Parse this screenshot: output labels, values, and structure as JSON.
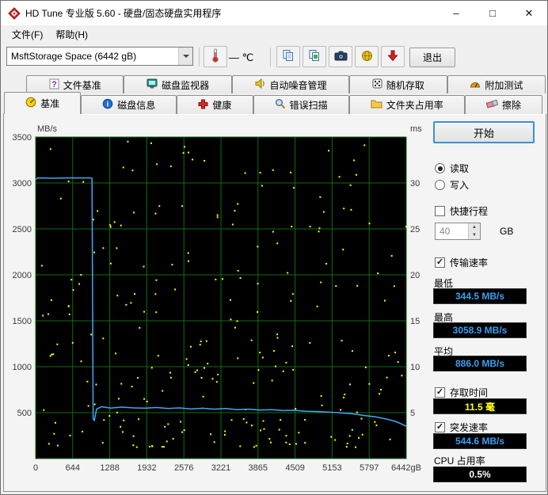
{
  "window": {
    "title": "HD Tune 专业版 5.60 - 硬盘/固态硬盘实用程序",
    "controls": {
      "minimize": "–",
      "maximize": "□",
      "close": "✕"
    }
  },
  "menu": {
    "file_label": "文件(F)",
    "help_label": "帮助(H)"
  },
  "toolbar": {
    "drive_select": "MsftStorage Space (6442 gB)",
    "temperature": "—",
    "temperature_unit": "℃",
    "exit_label": "退出"
  },
  "tabs": {
    "row1": [
      {
        "label": "文件基准"
      },
      {
        "label": "磁盘监视器"
      },
      {
        "label": "自动噪音管理"
      },
      {
        "label": "随机存取"
      },
      {
        "label": "附加测试"
      }
    ],
    "row2": [
      {
        "label": "基准",
        "active": true
      },
      {
        "label": "磁盘信息"
      },
      {
        "label": "健康"
      },
      {
        "label": "错误扫描"
      },
      {
        "label": "文件夹占用率"
      },
      {
        "label": "擦除"
      }
    ]
  },
  "panel": {
    "start_label": "开始",
    "read_label": "读取",
    "write_label": "写入",
    "shortstroke_label": "快捷行程",
    "shortstroke_value": "40",
    "shortstroke_unit": "GB",
    "transfer_label": "传输速率",
    "min_label": "最低",
    "min_value": "344.5 MB/s",
    "max_label": "最高",
    "max_value": "3058.9 MB/s",
    "avg_label": "平均",
    "avg_value": "886.0 MB/s",
    "access_label": "存取时间",
    "access_value": "11.5 毫",
    "burst_label": "突发速率",
    "burst_value": "544.6 MB/s",
    "cpu_label": "CPU 占用率",
    "cpu_value": "0.5%"
  },
  "colors": {
    "value_blue": "#35a2f0",
    "value_yellow": "#ffff00",
    "value_white": "#ffffff",
    "accent_border": "#3d8fd4"
  },
  "chart_data": {
    "type": "line+scatter",
    "title": "HD Tune 基准 读取测试",
    "x_axis": {
      "min": 0,
      "max": 6442,
      "tick_labels": [
        "0",
        "644",
        "1288",
        "1932",
        "2576",
        "3221",
        "3865",
        "4509",
        "5153",
        "5797",
        "6442gB"
      ]
    },
    "left_axis": {
      "unit": "MB/s",
      "min": 0,
      "max": 3500,
      "ticks": [
        3500,
        3000,
        2500,
        2000,
        1500,
        1000,
        500
      ]
    },
    "right_axis": {
      "unit": "ms",
      "min": 0,
      "max": 35,
      "ticks": [
        30,
        25,
        20,
        15,
        10,
        5
      ]
    },
    "grid": true,
    "bg": "#000000",
    "grid_color": "#0e6e0e",
    "transfer_line": {
      "name": "传输速率",
      "color": "#3fa9f5",
      "points": [
        [
          0,
          3040
        ],
        [
          40,
          3055
        ],
        [
          300,
          3052
        ],
        [
          600,
          3055
        ],
        [
          950,
          3055
        ],
        [
          980,
          3050
        ],
        [
          1000,
          430
        ],
        [
          1020,
          415
        ],
        [
          1060,
          540
        ],
        [
          1150,
          565
        ],
        [
          1300,
          550
        ],
        [
          1500,
          560
        ],
        [
          1700,
          552
        ],
        [
          1900,
          548
        ],
        [
          2100,
          556
        ],
        [
          2300,
          545
        ],
        [
          2500,
          552
        ],
        [
          2700,
          540
        ],
        [
          2900,
          548
        ],
        [
          3100,
          538
        ],
        [
          3300,
          545
        ],
        [
          3500,
          532
        ],
        [
          3700,
          538
        ],
        [
          3900,
          528
        ],
        [
          4100,
          532
        ],
        [
          4300,
          522
        ],
        [
          4500,
          526
        ],
        [
          4700,
          515
        ],
        [
          4900,
          512
        ],
        [
          5100,
          505
        ],
        [
          5300,
          498
        ],
        [
          5500,
          488
        ],
        [
          5700,
          470
        ],
        [
          5900,
          455
        ],
        [
          6100,
          430
        ],
        [
          6250,
          405
        ],
        [
          6350,
          380
        ],
        [
          6442,
          352
        ]
      ]
    },
    "access_scatter": {
      "name": "存取时间",
      "color": "#ffff00",
      "count": 250,
      "ms_min": 1.2,
      "ms_max": 34.5,
      "bias": 1.45,
      "seed": 1337
    },
    "summary": {
      "min_mbs": 344.5,
      "max_mbs": 3058.9,
      "avg_mbs": 886.0,
      "access_ms": 11.5,
      "burst_mbs": 544.6,
      "cpu_pct": 0.5
    }
  }
}
